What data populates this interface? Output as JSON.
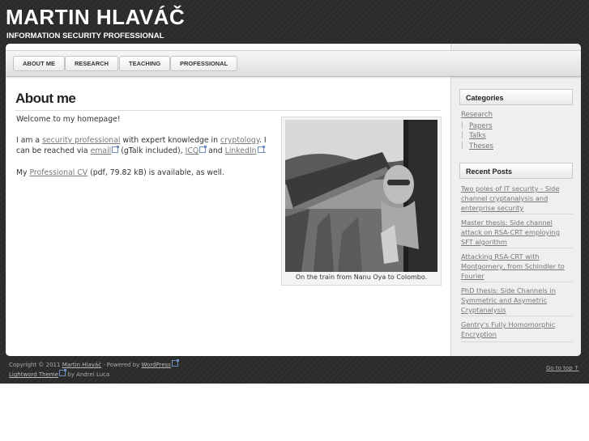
{
  "header": {
    "title": "MARTIN HLAVÁČ",
    "description": "INFORMATION SECURITY PROFESSIONAL"
  },
  "nav": {
    "tabs": [
      {
        "label": "ABOUT ME"
      },
      {
        "label": "RESEARCH"
      },
      {
        "label": "TEACHING"
      },
      {
        "label": "PROFESSIONAL"
      }
    ]
  },
  "page": {
    "title": "About me",
    "welcome": "Welcome to my homepage!",
    "p2": {
      "t1": "I am a ",
      "link_security": "security professional",
      "t2": " with expert knowledge in ",
      "link_crypto": "cryptology",
      "t3": ". I can be reached via ",
      "link_email": "email",
      "t4": " (gTalk included), ",
      "link_icq": "ICQ",
      "t5": " and ",
      "link_linkedin": "LinkedIn",
      "t6": "."
    },
    "p3": {
      "t1": "My ",
      "link_cv": "Professional CV",
      "t2": " (pdf, 79.82 kB) is available, as well."
    },
    "photo_caption": "On the train from Nanu Oya to Colombo."
  },
  "sidebar": {
    "categories_title": "Categories",
    "research": "Research",
    "sub": [
      "Papers",
      "Talks",
      "Theses"
    ],
    "recent_title": "Recent Posts",
    "posts": [
      "Two poles of IT security - Side channel cryptanalysis and enterprise security",
      "Master thesis: Side channel attack on RSA-CRT employing SFT algorithm",
      "Attacking RSA-CRT with Montgomery, from Schindler to Fourier",
      "PhD thesis: Side Channels in Symmetric and Asymetric Cryptanalysis",
      "Gentry's Fully Homomorphic Encryption"
    ]
  },
  "footer": {
    "copyright": "Copyright © 2011 ",
    "author": "Martin Hlaváč",
    "powered": " · Powered by ",
    "wordpress": "WordPress",
    "theme": "Lightword Theme",
    "by": " by Andrei Luca",
    "to_top": "Go to top ↑"
  }
}
